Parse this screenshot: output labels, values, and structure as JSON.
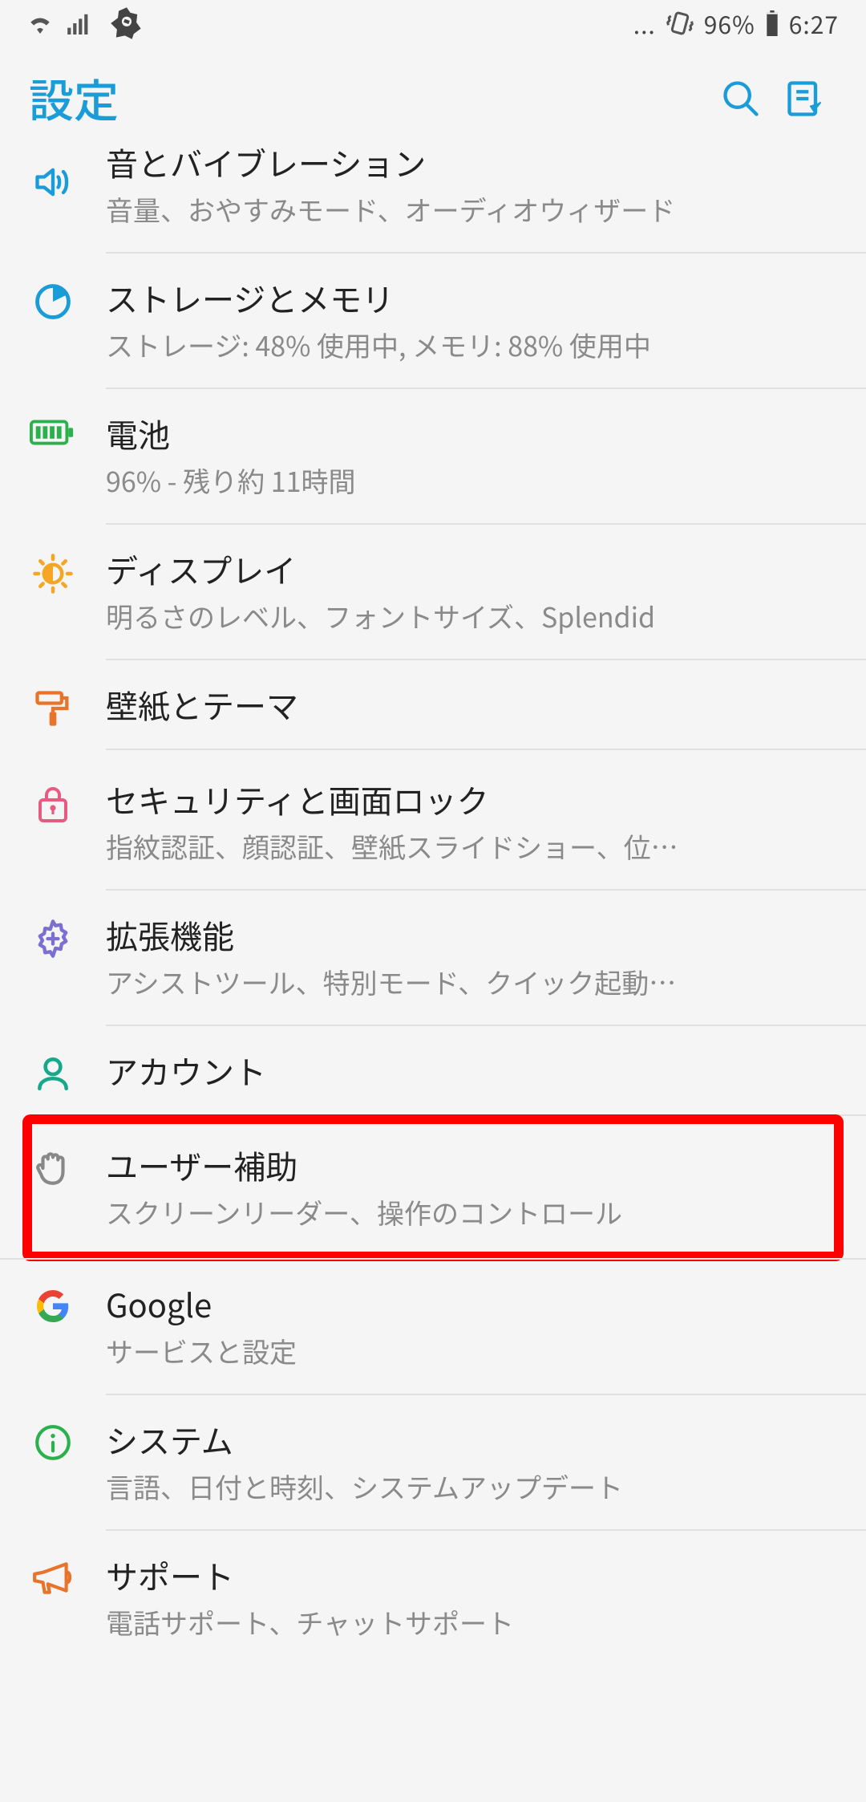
{
  "status": {
    "ellipsis": "...",
    "battery": "96%",
    "time": "6:27"
  },
  "header": {
    "title": "設定"
  },
  "items": [
    {
      "title": "音とバイブレーション",
      "sub": "音量、おやすみモード、オーディオウィザード"
    },
    {
      "title": "ストレージとメモリ",
      "sub": "ストレージ: 48% 使用中, メモリ: 88% 使用中"
    },
    {
      "title": "電池",
      "sub": "96% - 残り約 11時間"
    },
    {
      "title": "ディスプレイ",
      "sub": "明るさのレベル、フォントサイズ、Splendid"
    },
    {
      "title": "壁紙とテーマ",
      "sub": ""
    },
    {
      "title": "セキュリティと画面ロック",
      "sub": "指紋認証、顔認証、壁紙スライドショー、位…"
    },
    {
      "title": "拡張機能",
      "sub": "アシストツール、特別モード、クイック起動…"
    },
    {
      "title": "アカウント",
      "sub": ""
    },
    {
      "title": "ユーザー補助",
      "sub": "スクリーンリーダー、操作のコントロール"
    },
    {
      "title": "Google",
      "sub": "サービスと設定"
    },
    {
      "title": "システム",
      "sub": "言語、日付と時刻、システムアップデート"
    },
    {
      "title": "サポート",
      "sub": "電話サポート、チャットサポート"
    }
  ]
}
